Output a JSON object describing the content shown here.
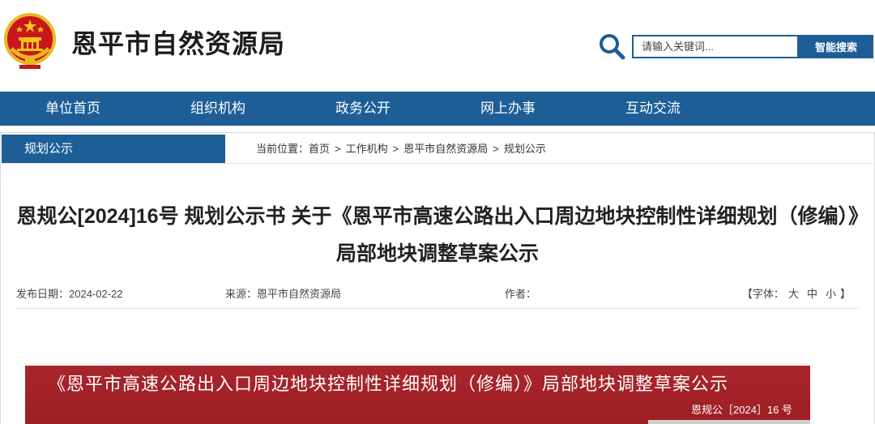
{
  "header": {
    "site_title": "恩平市自然资源局",
    "emblem_icon": "national-emblem-icon",
    "search": {
      "placeholder": "请输入关键词...",
      "button_label": "智能搜索",
      "icon": "search-icon"
    }
  },
  "nav": {
    "items": [
      {
        "label": "单位首页"
      },
      {
        "label": "组织机构"
      },
      {
        "label": "政务公开"
      },
      {
        "label": "网上办事"
      },
      {
        "label": "互动交流"
      }
    ]
  },
  "section": {
    "tab_label": "规划公示"
  },
  "breadcrumb": {
    "label": "当前位置：",
    "items": [
      "首页",
      "工作机构",
      "恩平市自然资源局",
      "规划公示"
    ],
    "separator": ">"
  },
  "article": {
    "title": "恩规公[2024]16号 规划公示书 关于《恩平市高速公路出入口周边地块控制性详细规划（修编）》局部地块调整草案公示",
    "meta": {
      "date": "发布日期：2024-02-22",
      "source": "来源：恩平市自然资源局",
      "author": "作者：",
      "font_label_open": "【字体：",
      "font_large": "大",
      "font_medium": "中",
      "font_small": "小",
      "font_label_close": "】"
    }
  },
  "document_banner": {
    "title": "《恩平市高速公路出入口周边地块控制性详细规划（修编）》局部地块调整草案公示",
    "number": "恩规公［2024］16 号"
  },
  "colors": {
    "primary_blue": "#1d5e97",
    "banner_red": "#a9252b"
  }
}
